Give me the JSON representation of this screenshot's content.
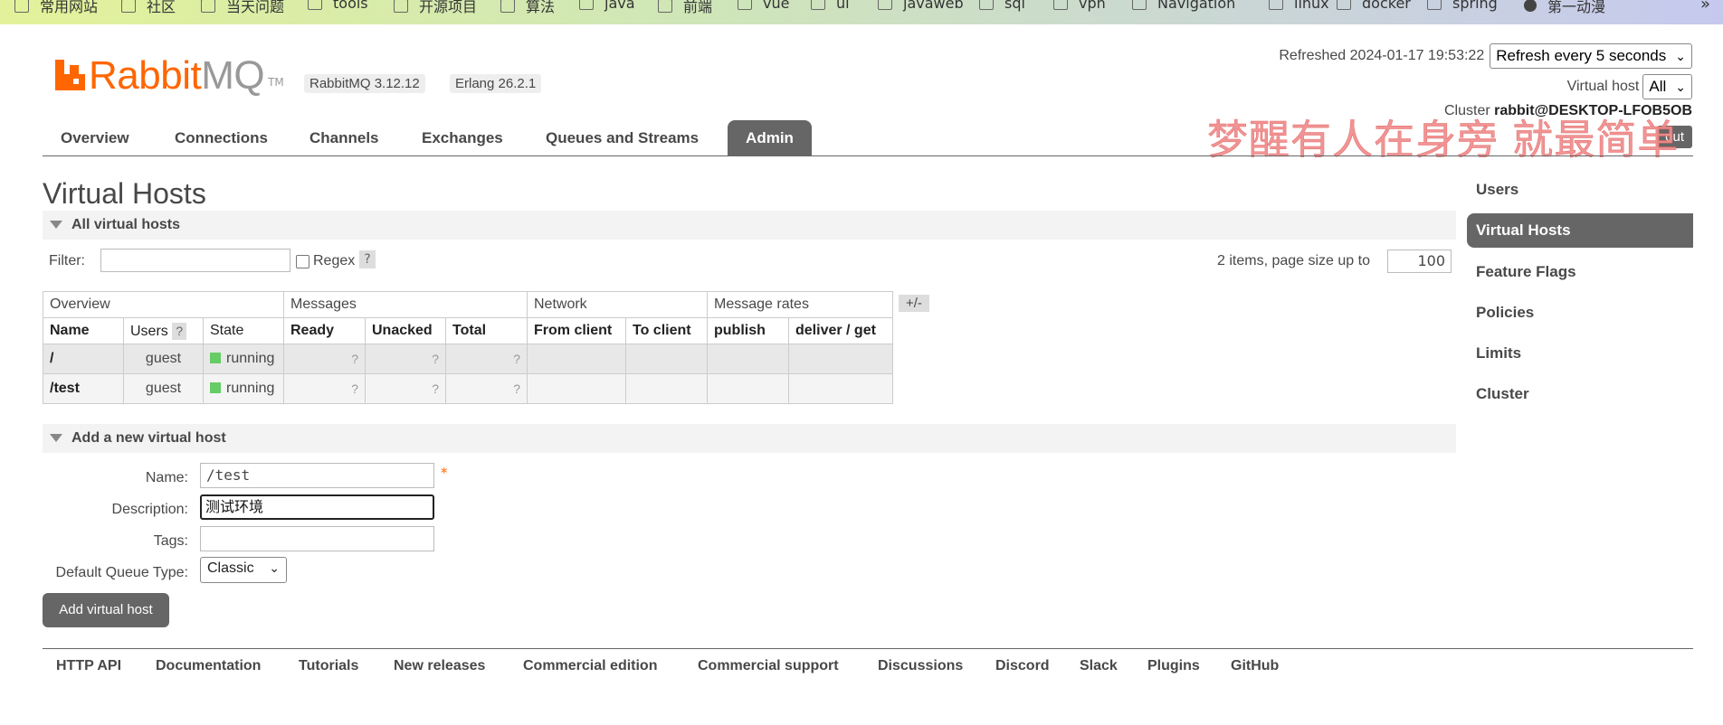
{
  "bookmarks": [
    {
      "label": "常用网站",
      "icon": "folder-icon"
    },
    {
      "label": "社区",
      "icon": "folder-icon"
    },
    {
      "label": "当天问题",
      "icon": "folder-icon"
    },
    {
      "label": "tools",
      "icon": "folder-icon"
    },
    {
      "label": "开源项目",
      "icon": "folder-icon"
    },
    {
      "label": "算法",
      "icon": "folder-icon"
    },
    {
      "label": "java",
      "icon": "folder-icon"
    },
    {
      "label": "前端",
      "icon": "folder-icon"
    },
    {
      "label": "vue",
      "icon": "folder-icon"
    },
    {
      "label": "ui",
      "icon": "folder-icon"
    },
    {
      "label": "javaweb",
      "icon": "folder-icon"
    },
    {
      "label": "sql",
      "icon": "folder-icon"
    },
    {
      "label": "vpn",
      "icon": "folder-icon"
    },
    {
      "label": "Navigation",
      "icon": "folder-icon"
    },
    {
      "label": "linux",
      "icon": "folder-icon"
    },
    {
      "label": "docker",
      "icon": "folder-icon"
    },
    {
      "label": "spring",
      "icon": "folder-icon"
    },
    {
      "label": "第一动漫",
      "icon": "globe-icon"
    }
  ],
  "bookmarks_more": "»",
  "header": {
    "logo_rabbit": "Rabbit",
    "logo_mq": "MQ",
    "logo_tm": "TM",
    "version": "RabbitMQ 3.12.12",
    "erlang": "Erlang 26.2.1",
    "refreshed_label": "Refreshed 2024-01-17 19:53:22",
    "refresh_option": "Refresh every 5 seconds",
    "vhost_label": "Virtual host",
    "vhost_value": "All",
    "cluster_label": "Cluster",
    "cluster_value": "rabbit@DESKTOP-LFOB5OB",
    "logout_label": "out",
    "watermark": "梦醒有人在身旁 就最简单",
    "colors": {
      "brand": "#ff6600",
      "tab_active": "#666666"
    }
  },
  "tabs": [
    "Overview",
    "Connections",
    "Channels",
    "Exchanges",
    "Queues and Streams",
    "Admin"
  ],
  "page_title": "Virtual Hosts",
  "all_section": {
    "title": "All virtual hosts",
    "filter_label": "Filter:",
    "filter_value": "",
    "regex_label": "Regex",
    "help": "?",
    "items_label": "2 items, page size up to",
    "page_size": "100"
  },
  "table": {
    "groups": [
      "Overview",
      "Messages",
      "Network",
      "Message rates"
    ],
    "columns": [
      "Name",
      "Users",
      "State",
      "Ready",
      "Unacked",
      "Total",
      "From client",
      "To client",
      "publish",
      "deliver / get"
    ],
    "users_help": "?",
    "plus_minus": "+/-",
    "rows": [
      {
        "name": "/",
        "users": "guest",
        "state": "running",
        "ready": "?",
        "unacked": "?",
        "total": "?"
      },
      {
        "name": "/test",
        "users": "guest",
        "state": "running",
        "ready": "?",
        "unacked": "?",
        "total": "?"
      }
    ]
  },
  "add_section": {
    "title": "Add a new virtual host",
    "name_label": "Name:",
    "name_value": "/test",
    "required": "*",
    "desc_label": "Description:",
    "desc_value": "测试环境",
    "tags_label": "Tags:",
    "tags_value": "",
    "queue_type_label": "Default Queue Type:",
    "queue_type_value": "Classic",
    "submit_label": "Add virtual host"
  },
  "footer": [
    "HTTP API",
    "Documentation",
    "Tutorials",
    "New releases",
    "Commercial edition",
    "Commercial support",
    "Discussions",
    "Discord",
    "Slack",
    "Plugins",
    "GitHub"
  ],
  "sidebar": [
    "Users",
    "Virtual Hosts",
    "Feature Flags",
    "Policies",
    "Limits",
    "Cluster"
  ]
}
